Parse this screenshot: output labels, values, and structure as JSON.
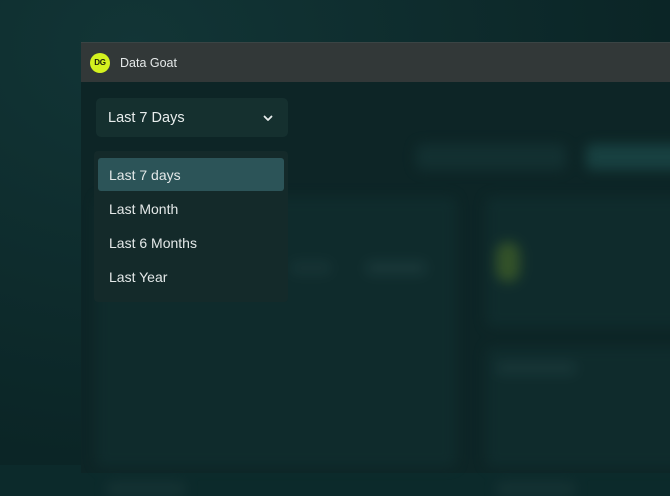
{
  "window": {
    "app_logo_text": "DG",
    "title": "Data Goat"
  },
  "date_range_select": {
    "selected_label": "Last 7 Days",
    "icon": "chevron-down-icon",
    "options": [
      {
        "label": "Last 7 days",
        "highlighted": true
      },
      {
        "label": "Last Month",
        "highlighted": false
      },
      {
        "label": "Last 6 Months",
        "highlighted": false
      },
      {
        "label": "Last Year",
        "highlighted": false
      }
    ]
  },
  "colors": {
    "brand_accent": "#d4f21f",
    "highlight": "#2c5458",
    "titlebar": "#323838",
    "background": "#0c2a2b"
  }
}
